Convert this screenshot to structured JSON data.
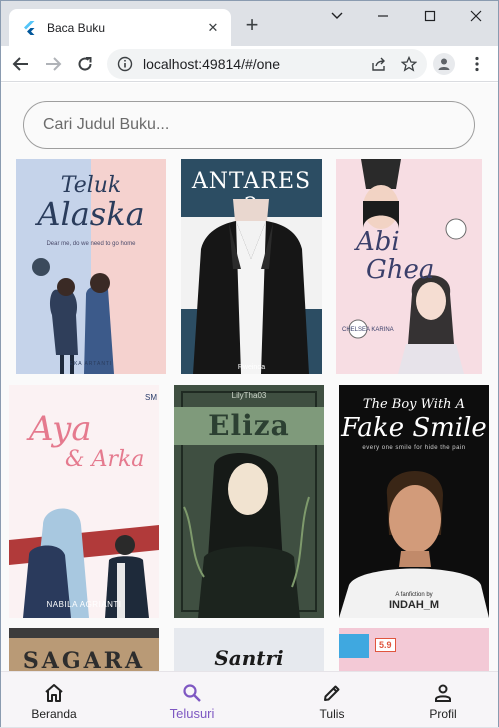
{
  "browser": {
    "tab_title": "Baca Buku",
    "url": "localhost:49814/#/one",
    "new_tab": "+",
    "close_tab": "✕",
    "minimize": "—",
    "maximize": "☐",
    "close_window": "✕",
    "tabs_dropdown": "⌄"
  },
  "search": {
    "placeholder": "Cari Judul Buku..."
  },
  "books": [
    {
      "title_a": "Teluk",
      "title_b": "Alaska",
      "tagline": "Dear me, do we need to go home",
      "author": "EKA ARTANTI"
    },
    {
      "title_a": "ANTARES 2",
      "author": "Rweinda"
    },
    {
      "title_a": "Abi",
      "title_b": "Ghea",
      "author": "CHELSEA KARINA"
    },
    {
      "title_a": "Aya",
      "title_b": "& Arka",
      "badge": "SM",
      "author": "NABILA AGRIANTI"
    },
    {
      "title_a": "Eliza",
      "author": "LilyTha03"
    },
    {
      "title_a": "The Boy With A",
      "title_b": "Fake Smile",
      "tagline": "every one smile for hide the pain",
      "subtitle": "A fanfiction by",
      "author": "INDAH_M"
    },
    {
      "title_a": "SAGARA"
    },
    {
      "title_a": "Santri"
    },
    {
      "badge": "5.9"
    }
  ],
  "bottom_nav": [
    {
      "label": "Beranda",
      "icon": "home-icon"
    },
    {
      "label": "Telusuri",
      "icon": "search-icon",
      "active": true
    },
    {
      "label": "Tulis",
      "icon": "pencil-icon"
    },
    {
      "label": "Profil",
      "icon": "person-icon"
    }
  ],
  "colors": {
    "accent": "#7e57c2",
    "chrome_bg": "#dee1e6"
  }
}
